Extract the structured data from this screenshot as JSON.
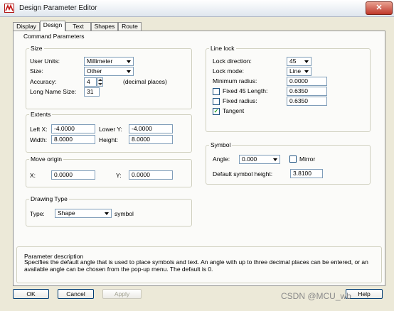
{
  "window": {
    "title": "Design Parameter Editor",
    "close_glyph": "✕"
  },
  "tabs": [
    {
      "label": "Display"
    },
    {
      "label": "Design",
      "active": true
    },
    {
      "label": "Text"
    },
    {
      "label": "Shapes"
    },
    {
      "label": "Route"
    }
  ],
  "command_parameters": {
    "title": "Command Parameters",
    "size": {
      "title": "Size",
      "user_units_label": "User Units:",
      "user_units_value": "Millimeter",
      "size_label": "Size:",
      "size_value": "Other",
      "accuracy_label": "Accuracy:",
      "accuracy_value": "4",
      "accuracy_suffix": "(decimal places)",
      "long_name_label": "Long Name Size:",
      "long_name_value": "31"
    },
    "extents": {
      "title": "Extents",
      "left_x_label": "Left X:",
      "left_x_value": "-4.0000",
      "lower_y_label": "Lower Y:",
      "lower_y_value": "-4.0000",
      "width_label": "Width:",
      "width_value": "8.0000",
      "height_label": "Height:",
      "height_value": "8.0000"
    },
    "move_origin": {
      "title": "Move origin",
      "x_label": "X:",
      "x_value": "0.0000",
      "y_label": "Y:",
      "y_value": "0.0000"
    },
    "drawing_type": {
      "title": "Drawing Type",
      "type_label": "Type:",
      "type_value": "Shape",
      "type_suffix": "symbol"
    },
    "line_lock": {
      "title": "Line lock",
      "lock_direction_label": "Lock direction:",
      "lock_direction_value": "45",
      "lock_mode_label": "Lock mode:",
      "lock_mode_value": "Line",
      "min_radius_label": "Minimum radius:",
      "min_radius_value": "0.0000",
      "fixed45_label": "Fixed 45 Length:",
      "fixed45_value": "0.6350",
      "fixed45_checked": false,
      "fixed_radius_label": "Fixed radius:",
      "fixed_radius_value": "0.6350",
      "fixed_radius_checked": false,
      "tangent_label": "Tangent",
      "tangent_checked": true
    },
    "symbol": {
      "title": "Symbol",
      "angle_label": "Angle:",
      "angle_value": "0.000",
      "mirror_label": "Mirror",
      "mirror_checked": false,
      "default_height_label": "Default symbol height:",
      "default_height_value": "3.8100"
    },
    "parameter_description": {
      "title": "Parameter description",
      "text": "Specifies the default angle that is used to place symbols and text. An angle with up to three decimal places can be entered, or an available angle can be chosen from the pop-up menu. The default is 0."
    }
  },
  "buttons": {
    "ok": "OK",
    "cancel": "Cancel",
    "apply": "Apply",
    "help": "Help"
  },
  "watermark": "CSDN @MCU_wb",
  "colors": {
    "dialog_bg": "#ece9d8",
    "panel_bg": "#fbfbf9",
    "check_green": "#21a121",
    "close_red": "#c0392b"
  }
}
